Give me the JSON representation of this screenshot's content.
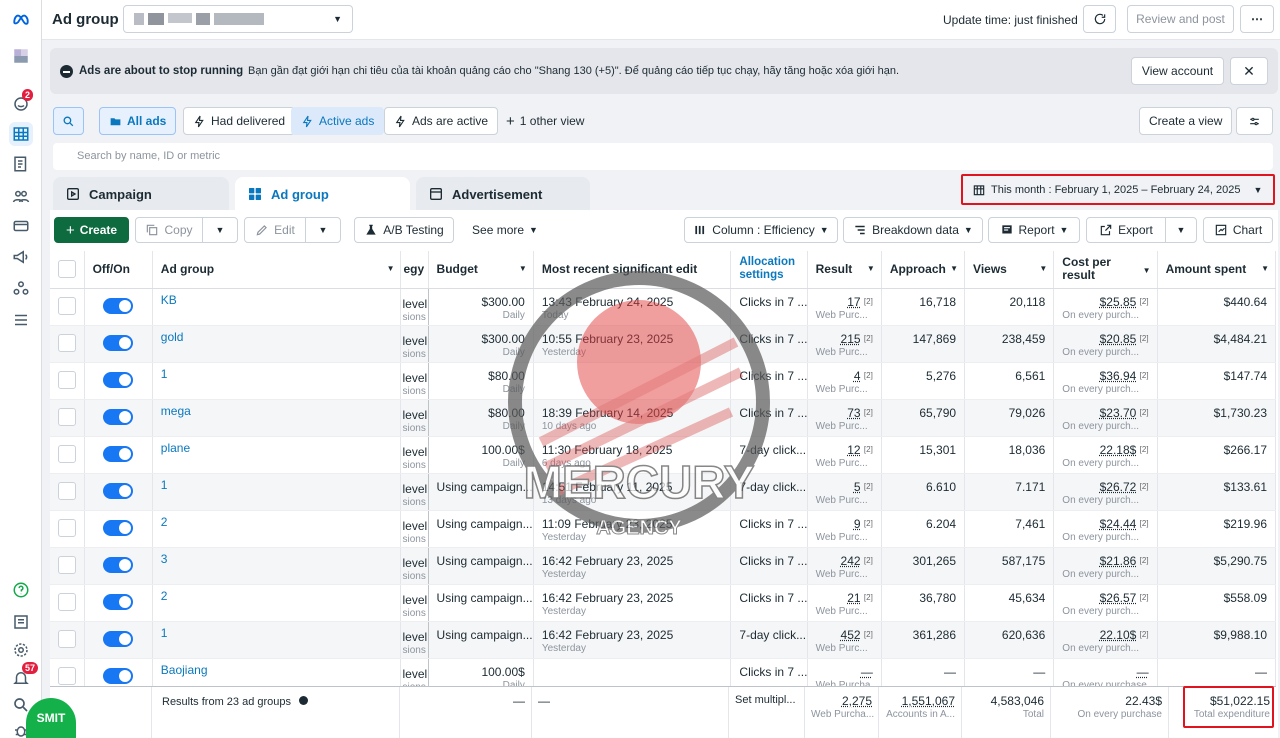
{
  "header": {
    "title": "Ad group",
    "update_time": "Update time: just finished",
    "review_btn": "Review and post",
    "more_btn": "⋯"
  },
  "banner": {
    "title": "Ads are about to stop running",
    "message": "Bạn gần đạt giới hạn chi tiêu của tài khoản quảng cáo cho \"Shang 130 (+5)\". Để quảng cáo tiếp tục chạy, hãy tăng hoặc xóa giới hạn.",
    "view_account": "View account"
  },
  "filters": {
    "all_ads": "All ads",
    "had_delivered": "Had delivered",
    "active_ads": "Active ads",
    "ads_are_active": "Ads are active",
    "other_view": "1 other view",
    "create_view": "Create a view",
    "search_placeholder": "Search by name, ID or metric"
  },
  "tabs": {
    "campaign": "Campaign",
    "ad_group": "Ad group",
    "advertisement": "Advertisement"
  },
  "date_range": "This month : February 1, 2025 – February 24, 2025",
  "toolbar": {
    "create": "Create",
    "copy": "Copy",
    "edit": "Edit",
    "ab_testing": "A/B Testing",
    "see_more": "See more",
    "column": "Column : Efficiency",
    "breakdown": "Breakdown data",
    "report": "Report",
    "export": "Export",
    "chart": "Chart"
  },
  "columns": {
    "offon": "Off/On",
    "ad_group": "Ad group",
    "strategy": "egy",
    "budget": "Budget",
    "recent_edit": "Most recent significant edit",
    "allocation": "Allocation settings",
    "result": "Result",
    "approach": "Approach",
    "views": "Views",
    "cost_per_result": "Cost per result",
    "amount_spent": "Amount spent"
  },
  "rows": [
    {
      "name": "KB",
      "strategy": "level",
      "strategy_sub": "sions",
      "budget": "$300.00",
      "budget_sub": "Daily",
      "edit": "13:43 February 24, 2025",
      "edit_sub": "Today",
      "alloc": "Clicks in 7 ...",
      "result": "17",
      "result_sub": "Web Purc...",
      "approach": "16,718",
      "views": "20,118",
      "cpr": "$25.85",
      "cpr_sub": "On every purch...",
      "spent": "$440.64"
    },
    {
      "name": "gold",
      "strategy": "level",
      "strategy_sub": "sions",
      "budget": "$300.00",
      "budget_sub": "Daily",
      "edit": "10:55 February 23, 2025",
      "edit_sub": "Yesterday",
      "alloc": "Clicks in 7 ...",
      "result": "215",
      "result_sub": "Web Purc...",
      "approach": "147,869",
      "views": "238,459",
      "cpr": "$20.85",
      "cpr_sub": "On every purch...",
      "spent": "$4,484.21"
    },
    {
      "name": "1",
      "strategy": "level",
      "strategy_sub": "sions",
      "budget": "$80.00",
      "budget_sub": "Daily",
      "edit": "",
      "edit_sub": "",
      "alloc": "Clicks in 7 ...",
      "result": "4",
      "result_sub": "Web Purc...",
      "approach": "5,276",
      "views": "6,561",
      "cpr": "$36.94",
      "cpr_sub": "On every purch...",
      "spent": "$147.74"
    },
    {
      "name": "mega",
      "strategy": "level",
      "strategy_sub": "sions",
      "budget": "$80.00",
      "budget_sub": "Daily",
      "edit": "18:39 February 14, 2025",
      "edit_sub": "10 days ago",
      "alloc": "Clicks in 7 ...",
      "result": "73",
      "result_sub": "Web Purc...",
      "approach": "65,790",
      "views": "79,026",
      "cpr": "$23.70",
      "cpr_sub": "On every purch...",
      "spent": "$1,730.23"
    },
    {
      "name": "plane",
      "strategy": "level",
      "strategy_sub": "sions",
      "budget": "100.00$",
      "budget_sub": "Daily",
      "edit": "11:30 February 18, 2025",
      "edit_sub": "6 days ago",
      "alloc": "7-day click...",
      "result": "12",
      "result_sub": "Web Purc...",
      "approach": "15,301",
      "views": "18,036",
      "cpr": "22.18$",
      "cpr_sub": "On every purch...",
      "spent": "$266.17"
    },
    {
      "name": "1",
      "strategy": "level",
      "strategy_sub": "sions",
      "budget": "Using campaign...",
      "budget_sub": "",
      "edit": "14:51 February 11, 2025",
      "edit_sub": "13 days ago",
      "alloc": "7-day click...",
      "result": "5",
      "result_sub": "Web Purc...",
      "approach": "6.610",
      "views": "7.171",
      "cpr": "$26.72",
      "cpr_sub": "On every purch...",
      "spent": "$133.61"
    },
    {
      "name": "2",
      "strategy": "level",
      "strategy_sub": "sions",
      "budget": "Using campaign...",
      "budget_sub": "",
      "edit": "11:09 February 23, 2025",
      "edit_sub": "Yesterday",
      "alloc": "Clicks in 7 ...",
      "result": "9",
      "result_sub": "Web Purc...",
      "approach": "6.204",
      "views": "7,461",
      "cpr": "$24.44",
      "cpr_sub": "On every purch...",
      "spent": "$219.96"
    },
    {
      "name": "3",
      "strategy": "level",
      "strategy_sub": "sions",
      "budget": "Using campaign...",
      "budget_sub": "",
      "edit": "16:42 February 23, 2025",
      "edit_sub": "Yesterday",
      "alloc": "Clicks in 7 ...",
      "result": "242",
      "result_sub": "Web Purc...",
      "approach": "301,265",
      "views": "587,175",
      "cpr": "$21.86",
      "cpr_sub": "On every purch...",
      "spent": "$5,290.75"
    },
    {
      "name": "2",
      "strategy": "level",
      "strategy_sub": "sions",
      "budget": "Using campaign...",
      "budget_sub": "",
      "edit": "16:42 February 23, 2025",
      "edit_sub": "Yesterday",
      "alloc": "Clicks in 7 ...",
      "result": "21",
      "result_sub": "Web Purc...",
      "approach": "36,780",
      "views": "45,634",
      "cpr": "$26.57",
      "cpr_sub": "On every purch...",
      "spent": "$558.09"
    },
    {
      "name": "1",
      "strategy": "level",
      "strategy_sub": "sions",
      "budget": "Using campaign...",
      "budget_sub": "",
      "edit": "16:42 February 23, 2025",
      "edit_sub": "Yesterday",
      "alloc": "7-day click...",
      "result": "452",
      "result_sub": "Web Purc...",
      "approach": "361,286",
      "views": "620,636",
      "cpr": "22.10$",
      "cpr_sub": "On every purch...",
      "spent": "$9,988.10"
    },
    {
      "name": "Baojiang",
      "strategy": "level",
      "strategy_sub": "sions",
      "budget": "100.00$",
      "budget_sub": "Daily",
      "edit": "",
      "edit_sub": "",
      "alloc": "Clicks in 7 ...",
      "result": "—",
      "result_sub": "Web Purcha...",
      "approach": "—",
      "views": "—",
      "cpr": "—",
      "cpr_sub": "On every purchase",
      "spent": "—"
    }
  ],
  "totals": {
    "label": "Results from 23 ad groups",
    "budget": "—",
    "alloc": "Set multipl...",
    "result": "2,275",
    "result_sub": "Web Purcha...",
    "approach": "1,551,067",
    "approach_sub": "Accounts in A...",
    "views": "4,583,046",
    "views_sub": "Total",
    "cpr": "22.43$",
    "cpr_sub": "On every purchase",
    "spent": "$51,022.15",
    "spent_sub": "Total expenditure"
  },
  "badges": {
    "notifications": "2",
    "alerts": "57"
  },
  "watermark": {
    "line1": "MERCURY",
    "line2": "AGENCY"
  },
  "smit_logo": "SMIT",
  "colors": {
    "accent": "#0a78be",
    "toggle": "#1877f2",
    "create": "#0e6b3f",
    "highlight": "#e0141e"
  }
}
